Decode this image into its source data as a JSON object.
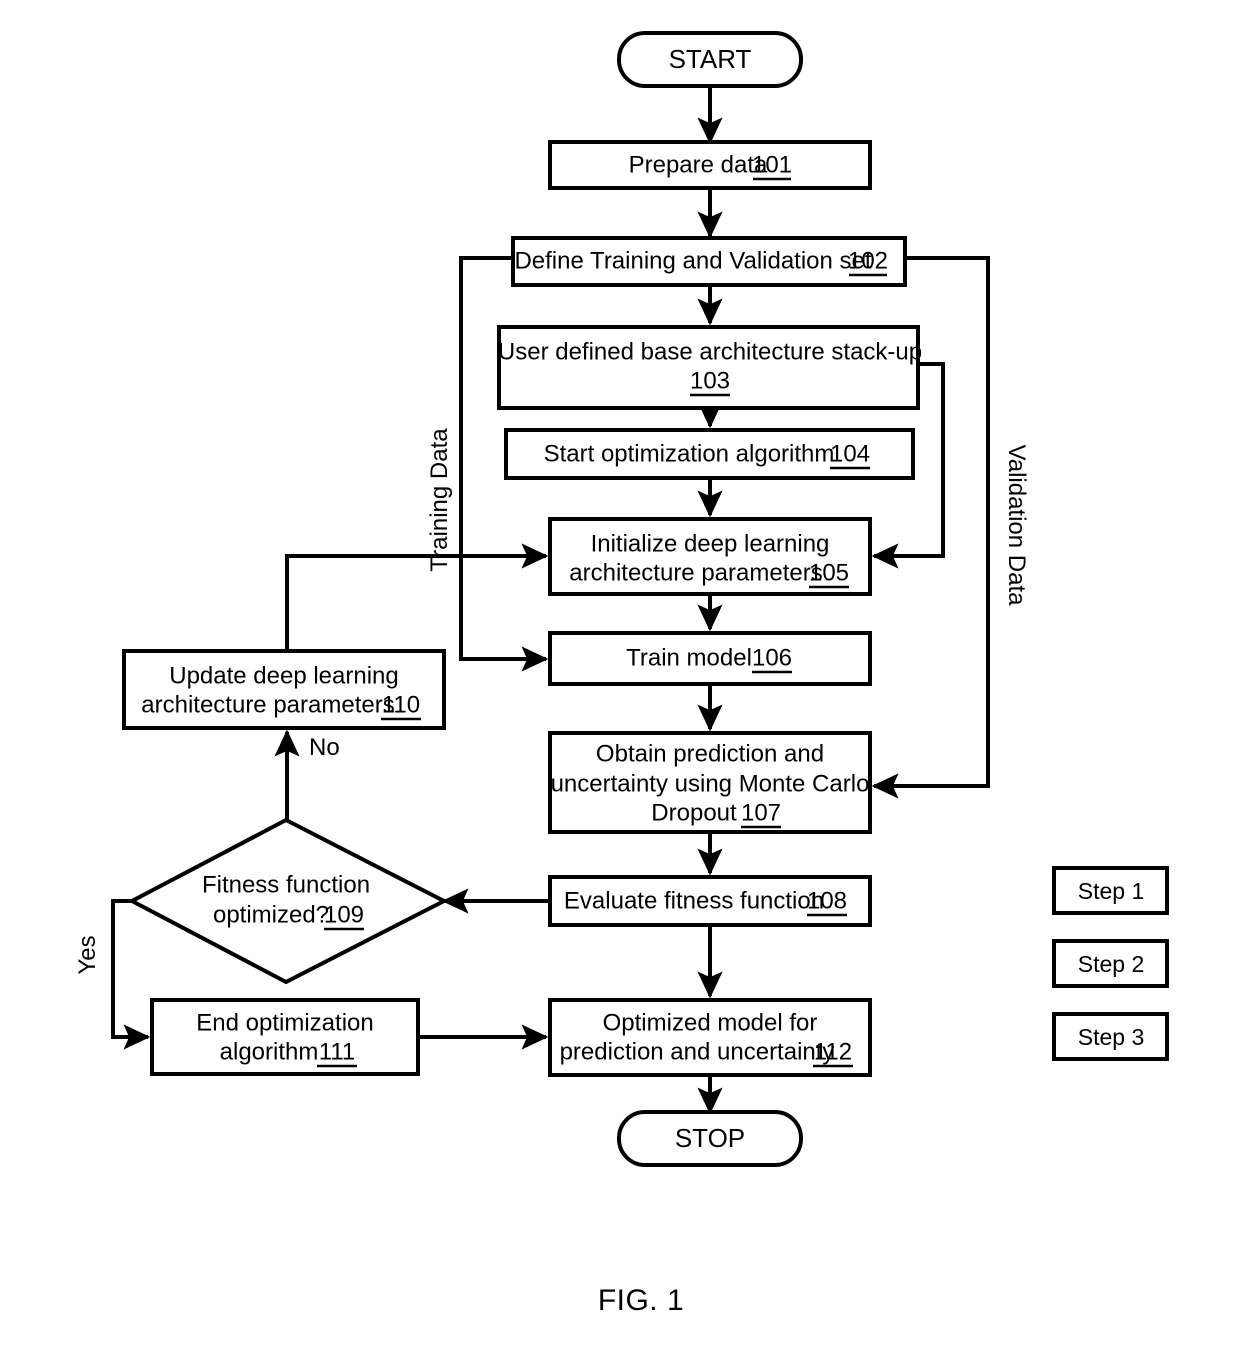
{
  "figure": {
    "caption": "FIG. 1",
    "terminators": {
      "start": "START",
      "stop": "STOP"
    },
    "nodes": [
      {
        "id": "n101",
        "ref": "101",
        "lines": [
          "Prepare data"
        ],
        "step": "step1",
        "shape": "rect"
      },
      {
        "id": "n102",
        "ref": "102",
        "lines": [
          "Define Training and Validation set"
        ],
        "step": "step1",
        "shape": "rect"
      },
      {
        "id": "n103",
        "ref": "103",
        "lines": [
          "User defined base architecture stack-up"
        ],
        "step": "step2",
        "shape": "rect"
      },
      {
        "id": "n104",
        "ref": "104",
        "lines": [
          "Start optimization algorithm"
        ],
        "step": "step3",
        "shape": "rect"
      },
      {
        "id": "n105",
        "ref": "105",
        "lines": [
          "Initialize deep learning",
          "architecture parameters"
        ],
        "step": "step2",
        "shape": "rect"
      },
      {
        "id": "n106",
        "ref": "106",
        "lines": [
          "Train model"
        ],
        "step": "step2",
        "shape": "rect"
      },
      {
        "id": "n107",
        "ref": "107",
        "lines": [
          "Obtain prediction and",
          "uncertainty using Monte Carlo",
          "Dropout"
        ],
        "step": "step2",
        "shape": "rect"
      },
      {
        "id": "n108",
        "ref": "108",
        "lines": [
          "Evaluate fitness function"
        ],
        "step": "step3",
        "shape": "rect"
      },
      {
        "id": "n109",
        "ref": "109",
        "lines": [
          "Fitness function",
          "optimized?"
        ],
        "step": "step3",
        "shape": "diamond"
      },
      {
        "id": "n110",
        "ref": "110",
        "lines": [
          "Update deep learning",
          "architecture parameters"
        ],
        "step": "step3",
        "shape": "rect"
      },
      {
        "id": "n111",
        "ref": "111",
        "lines": [
          "End optimization",
          "algorithm"
        ],
        "step": "step3",
        "shape": "rect"
      },
      {
        "id": "n112",
        "ref": "112",
        "lines": [
          "Optimized model for",
          "prediction and uncertainty"
        ],
        "step": "step1",
        "shape": "rect"
      }
    ],
    "edge_labels": {
      "training_data": "Training Data",
      "validation_data": "Validation Data",
      "no": "No",
      "yes": "Yes"
    },
    "legend": [
      {
        "label": "Step 1",
        "fill": "step1"
      },
      {
        "label": "Step 2",
        "fill": "step2"
      },
      {
        "label": "Step 3",
        "fill": "step3"
      }
    ],
    "colors": {
      "stroke": "#000000",
      "background": "#ffffff",
      "step1_fill": "#ffffff",
      "step2_fill": "#e3e3e3",
      "step3_fill": "#d3d3d3"
    }
  }
}
